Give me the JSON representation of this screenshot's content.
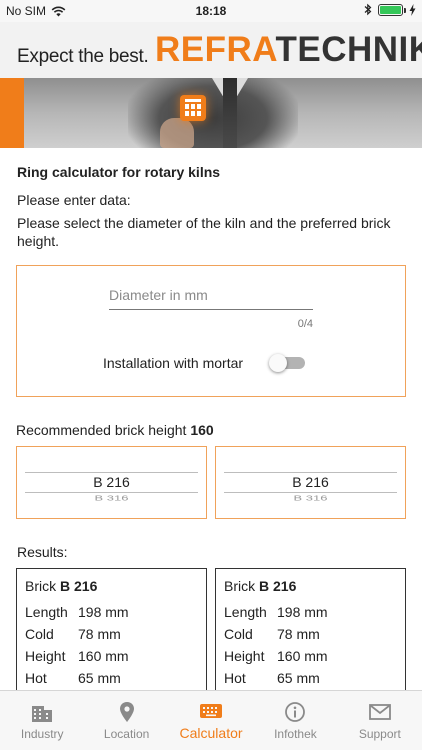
{
  "status": {
    "carrier": "No SIM",
    "time": "18:18"
  },
  "header": {
    "tagline": "Expect the best.",
    "logo_part1": "REFRA",
    "logo_part2": "TECHNIK",
    "accent_color": "#f07d1a"
  },
  "page": {
    "title": "Ring calculator for rotary kilns",
    "enter_label": "Please enter data:",
    "instruction": "Please select the diameter of the kiln and the preferred brick height."
  },
  "form": {
    "diameter_value": "",
    "diameter_placeholder": "Diameter in mm",
    "counter": "0/4",
    "mortar_label": "Installation with mortar",
    "mortar_enabled": false
  },
  "recommendation": {
    "label": "Recommended brick height",
    "value": "160"
  },
  "pickers": [
    {
      "selected": "B 216",
      "next": "B 316"
    },
    {
      "selected": "B 216",
      "next": "B 316"
    }
  ],
  "results": {
    "label": "Results:",
    "cards": [
      {
        "brick_label": "Brick",
        "brick_value": "B 216",
        "rows": [
          {
            "key": "Length",
            "value": "198 mm"
          },
          {
            "key": "Cold",
            "value": "78 mm"
          },
          {
            "key": "Height",
            "value": "160 mm"
          },
          {
            "key": "Hot",
            "value": "65 mm"
          }
        ]
      },
      {
        "brick_label": "Brick",
        "brick_value": "B 216",
        "rows": [
          {
            "key": "Length",
            "value": "198 mm"
          },
          {
            "key": "Cold",
            "value": "78 mm"
          },
          {
            "key": "Height",
            "value": "160 mm"
          },
          {
            "key": "Hot",
            "value": "65 mm"
          }
        ]
      }
    ]
  },
  "tabs": [
    {
      "label": "Industry",
      "icon": "building-icon",
      "active": false
    },
    {
      "label": "Location",
      "icon": "location-pin-icon",
      "active": false
    },
    {
      "label": "Calculator",
      "icon": "keyboard-icon",
      "active": true
    },
    {
      "label": "Infothek",
      "icon": "info-icon",
      "active": false
    },
    {
      "label": "Support",
      "icon": "mail-icon",
      "active": false
    }
  ]
}
